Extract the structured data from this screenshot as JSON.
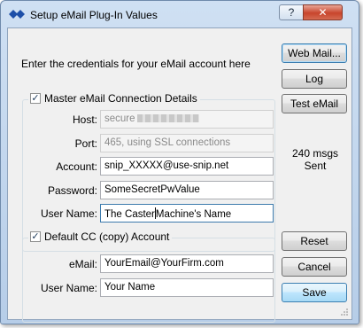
{
  "window": {
    "title": "Setup eMail Plug-In Values",
    "help_label": "?",
    "close_label": "✕"
  },
  "intro_text": "Enter the credentials for your eMail account here",
  "master": {
    "checkbox_label": "Master eMail Connection Details",
    "checked": true,
    "host": {
      "label": "Host:",
      "value": "secure"
    },
    "port": {
      "label": "Port:",
      "value": "465, using SSL connections"
    },
    "account": {
      "label": "Account:",
      "value": "snip_XXXXX@use-snip.net"
    },
    "password": {
      "label": "Password:",
      "value": "SomeSecretPwValue"
    },
    "username": {
      "label": "User Name:",
      "value_before_caret": "The Caster",
      "value_after_caret": "Machine's Name"
    }
  },
  "cc": {
    "checkbox_label": "Default CC (copy) Account",
    "checked": true,
    "email": {
      "label": "eMail:",
      "value": "YourEmail@YourFirm.com"
    },
    "username": {
      "label": "User Name:",
      "value": "Your Name"
    }
  },
  "buttons": {
    "web_mail": "Web Mail...",
    "log": "Log",
    "test_email": "Test eMail",
    "reset": "Reset",
    "cancel": "Cancel",
    "save": "Save"
  },
  "status_text": "240 msgs Sent",
  "colors": {
    "title_gradient": "#cfe0f3",
    "close_button": "#c8452c",
    "save_button": "#bee6fd",
    "client_bg": "#f0f0f0"
  }
}
